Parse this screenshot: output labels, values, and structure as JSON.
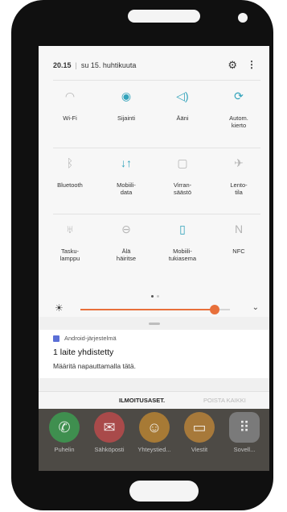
{
  "status": {
    "time": "20.15",
    "separator": "|",
    "date": "su 15. huhtikuuta",
    "settings_icon": "gear-icon",
    "more_icon": "more-vertical-icon"
  },
  "quick_settings": [
    {
      "label": "Wi-Fi",
      "icon": "wifi-icon",
      "active": false
    },
    {
      "label": "Sijainti",
      "icon": "location-icon",
      "active": true
    },
    {
      "label": "Ääni",
      "icon": "volume-icon",
      "active": true
    },
    {
      "label": "Autom.\nkierto",
      "icon": "auto-rotate-icon",
      "active": true
    },
    {
      "label": "Bluetooth",
      "icon": "bluetooth-icon",
      "active": false
    },
    {
      "label": "Mobiili-\ndata",
      "icon": "mobile-data-icon",
      "active": true
    },
    {
      "label": "Virran-\nsäästö",
      "icon": "power-saving-icon",
      "active": false
    },
    {
      "label": "Lento-\ntila",
      "icon": "airplane-icon",
      "active": false
    },
    {
      "label": "Tasku-\nlamppu",
      "icon": "flashlight-icon",
      "active": false
    },
    {
      "label": "Älä\nhäiritse",
      "icon": "do-not-disturb-icon",
      "active": false
    },
    {
      "label": "Mobiili-\ntukiasema",
      "icon": "hotspot-icon",
      "active": true
    },
    {
      "label": "NFC",
      "icon": "nfc-icon",
      "active": false
    }
  ],
  "page_indicator": {
    "current": 1,
    "total": 2
  },
  "brightness": {
    "level": 0.9,
    "accent": "#e8703b"
  },
  "notification": {
    "source": "Android-järjestelmä",
    "title": "1 laite yhdistetty",
    "body": "Määritä napauttamalla tätä."
  },
  "actions": {
    "settings": "ILMOITUSASET.",
    "clear_all": "POISTA KAIKKI"
  },
  "dock_apps": [
    {
      "label": "Puhelin",
      "icon": "phone-icon",
      "color": "#3f8f4f"
    },
    {
      "label": "Sähköposti",
      "icon": "mail-icon",
      "color": "#a94a4a"
    },
    {
      "label": "Yhteystied...",
      "icon": "contacts-icon",
      "color": "#a77a35"
    },
    {
      "label": "Viestit",
      "icon": "messages-icon",
      "color": "#a7793a"
    },
    {
      "label": "Sovell...",
      "icon": "apps-icon",
      "color": "#7a7a7a"
    }
  ]
}
